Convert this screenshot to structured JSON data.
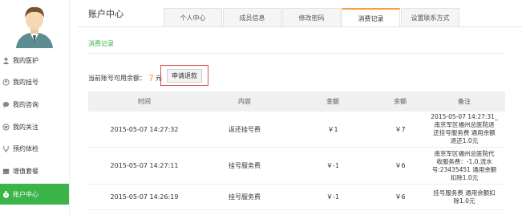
{
  "sidebar": {
    "items": [
      {
        "label": "我的医护",
        "icon": "person-icon"
      },
      {
        "label": "我的挂号",
        "icon": "user-icon"
      },
      {
        "label": "我的咨询",
        "icon": "chat-icon"
      },
      {
        "label": "我的关注",
        "icon": "heart-icon"
      },
      {
        "label": "预约体检",
        "icon": "stethoscope-icon"
      },
      {
        "label": "增值套餐",
        "icon": "package-icon"
      },
      {
        "label": "账户中心",
        "icon": "money-bag-icon",
        "active": true
      }
    ],
    "active_color": "#3bb54a"
  },
  "page": {
    "title": "账户中心",
    "tabs": [
      "个人中心",
      "成员信息",
      "修改密码",
      "消费记录",
      "设置联系方式"
    ],
    "active_tab": 3,
    "accent": "#f2a23a"
  },
  "section": {
    "title": "消费记录",
    "balance_label": "当前账号可用余额：",
    "balance_value": "7",
    "balance_unit": "元",
    "refund_button": "申请退款"
  },
  "table": {
    "headers": [
      "时间",
      "内容",
      "金额",
      "余额",
      "备注"
    ],
    "rows": [
      {
        "time": "2015-05-07 14:27:32",
        "content": "返还挂号费",
        "amount": "￥1",
        "balance": "￥7",
        "note": [
          "2015-05-07 14:27:31_",
          "南京军区福州总医院退",
          "还挂号服务费 通用余额",
          "退还1.0元"
        ]
      },
      {
        "time": "2015-05-07 14:27:11",
        "content": "挂号服务费",
        "amount": "￥-1",
        "balance": "￥6",
        "note": [
          "南京军区福州总医院代",
          "收服务费：-1.0,流水",
          "号:23435451 通用余额",
          "扣除1.0元"
        ]
      },
      {
        "time": "2015-05-07 14:26:19",
        "content": "挂号服务费",
        "amount": "￥-1",
        "balance": "￥6",
        "note": [
          "挂号服务费 通用余额扣",
          "除1.0元"
        ]
      }
    ]
  }
}
